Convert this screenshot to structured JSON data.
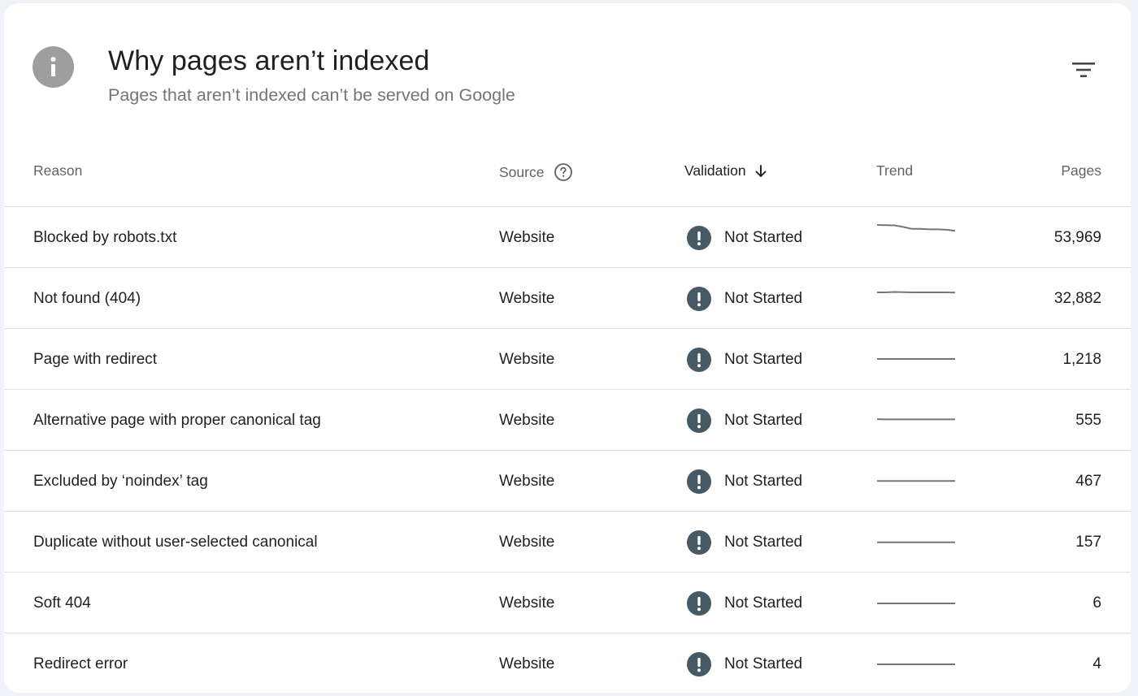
{
  "header": {
    "title": "Why pages aren’t indexed",
    "subtitle": "Pages that aren’t indexed can’t be served on Google"
  },
  "columns": {
    "reason": "Reason",
    "source": "Source",
    "validation": "Validation",
    "trend": "Trend",
    "pages": "Pages"
  },
  "colors": {
    "status_icon": "#455a64",
    "trend_line": "#757575",
    "info_icon": "#9e9e9e"
  },
  "rows": [
    {
      "reason": "Blocked by robots.txt",
      "source": "Website",
      "validation": "Not Started",
      "pages": "53,969",
      "trend": [
        1.0,
        0.98,
        0.97,
        0.85,
        0.7,
        0.7,
        0.66,
        0.66,
        0.63,
        0.55
      ]
    },
    {
      "reason": "Not found (404)",
      "source": "Website",
      "validation": "Not Started",
      "pages": "32,882",
      "trend": [
        0.5,
        0.5,
        0.53,
        0.51,
        0.5,
        0.5,
        0.5,
        0.5,
        0.5,
        0.48
      ]
    },
    {
      "reason": "Page with redirect",
      "source": "Website",
      "validation": "Not Started",
      "pages": "1,218",
      "trend": [
        0.06,
        0.06,
        0.06,
        0.06,
        0.06,
        0.06,
        0.06,
        0.06,
        0.06,
        0.06
      ]
    },
    {
      "reason": "Alternative page with proper canonical tag",
      "source": "Website",
      "validation": "Not Started",
      "pages": "555",
      "trend": [
        0.12,
        0.1,
        0.1,
        0.1,
        0.1,
        0.1,
        0.1,
        0.1,
        0.1,
        0.1
      ]
    },
    {
      "reason": "Excluded by ‘noindex’ tag",
      "source": "Website",
      "validation": "Not Started",
      "pages": "467",
      "trend": [
        0.05,
        0.05,
        0.05,
        0.05,
        0.05,
        0.05,
        0.05,
        0.05,
        0.05,
        0.05
      ]
    },
    {
      "reason": "Duplicate without user-selected canonical",
      "source": "Website",
      "validation": "Not Started",
      "pages": "157",
      "trend": [
        0.02,
        0.02,
        0.02,
        0.02,
        0.02,
        0.02,
        0.02,
        0.02,
        0.02,
        0.02
      ]
    },
    {
      "reason": "Soft 404",
      "source": "Website",
      "validation": "Not Started",
      "pages": "6",
      "trend": [
        0.0,
        0.0,
        0.0,
        0.0,
        0.0,
        0.0,
        0.0,
        0.0,
        0.0,
        0.0
      ]
    },
    {
      "reason": "Redirect error",
      "source": "Website",
      "validation": "Not Started",
      "pages": "4",
      "trend": [
        0.0,
        0.0,
        0.0,
        0.0,
        0.0,
        0.0,
        0.0,
        0.0,
        0.0,
        0.0
      ]
    }
  ],
  "icons": {
    "header": "info-icon",
    "filter": "filter-icon",
    "source_help": "help-circle-icon",
    "validation_sort": "arrow-down-icon",
    "status": "exclamation-circle-icon"
  }
}
